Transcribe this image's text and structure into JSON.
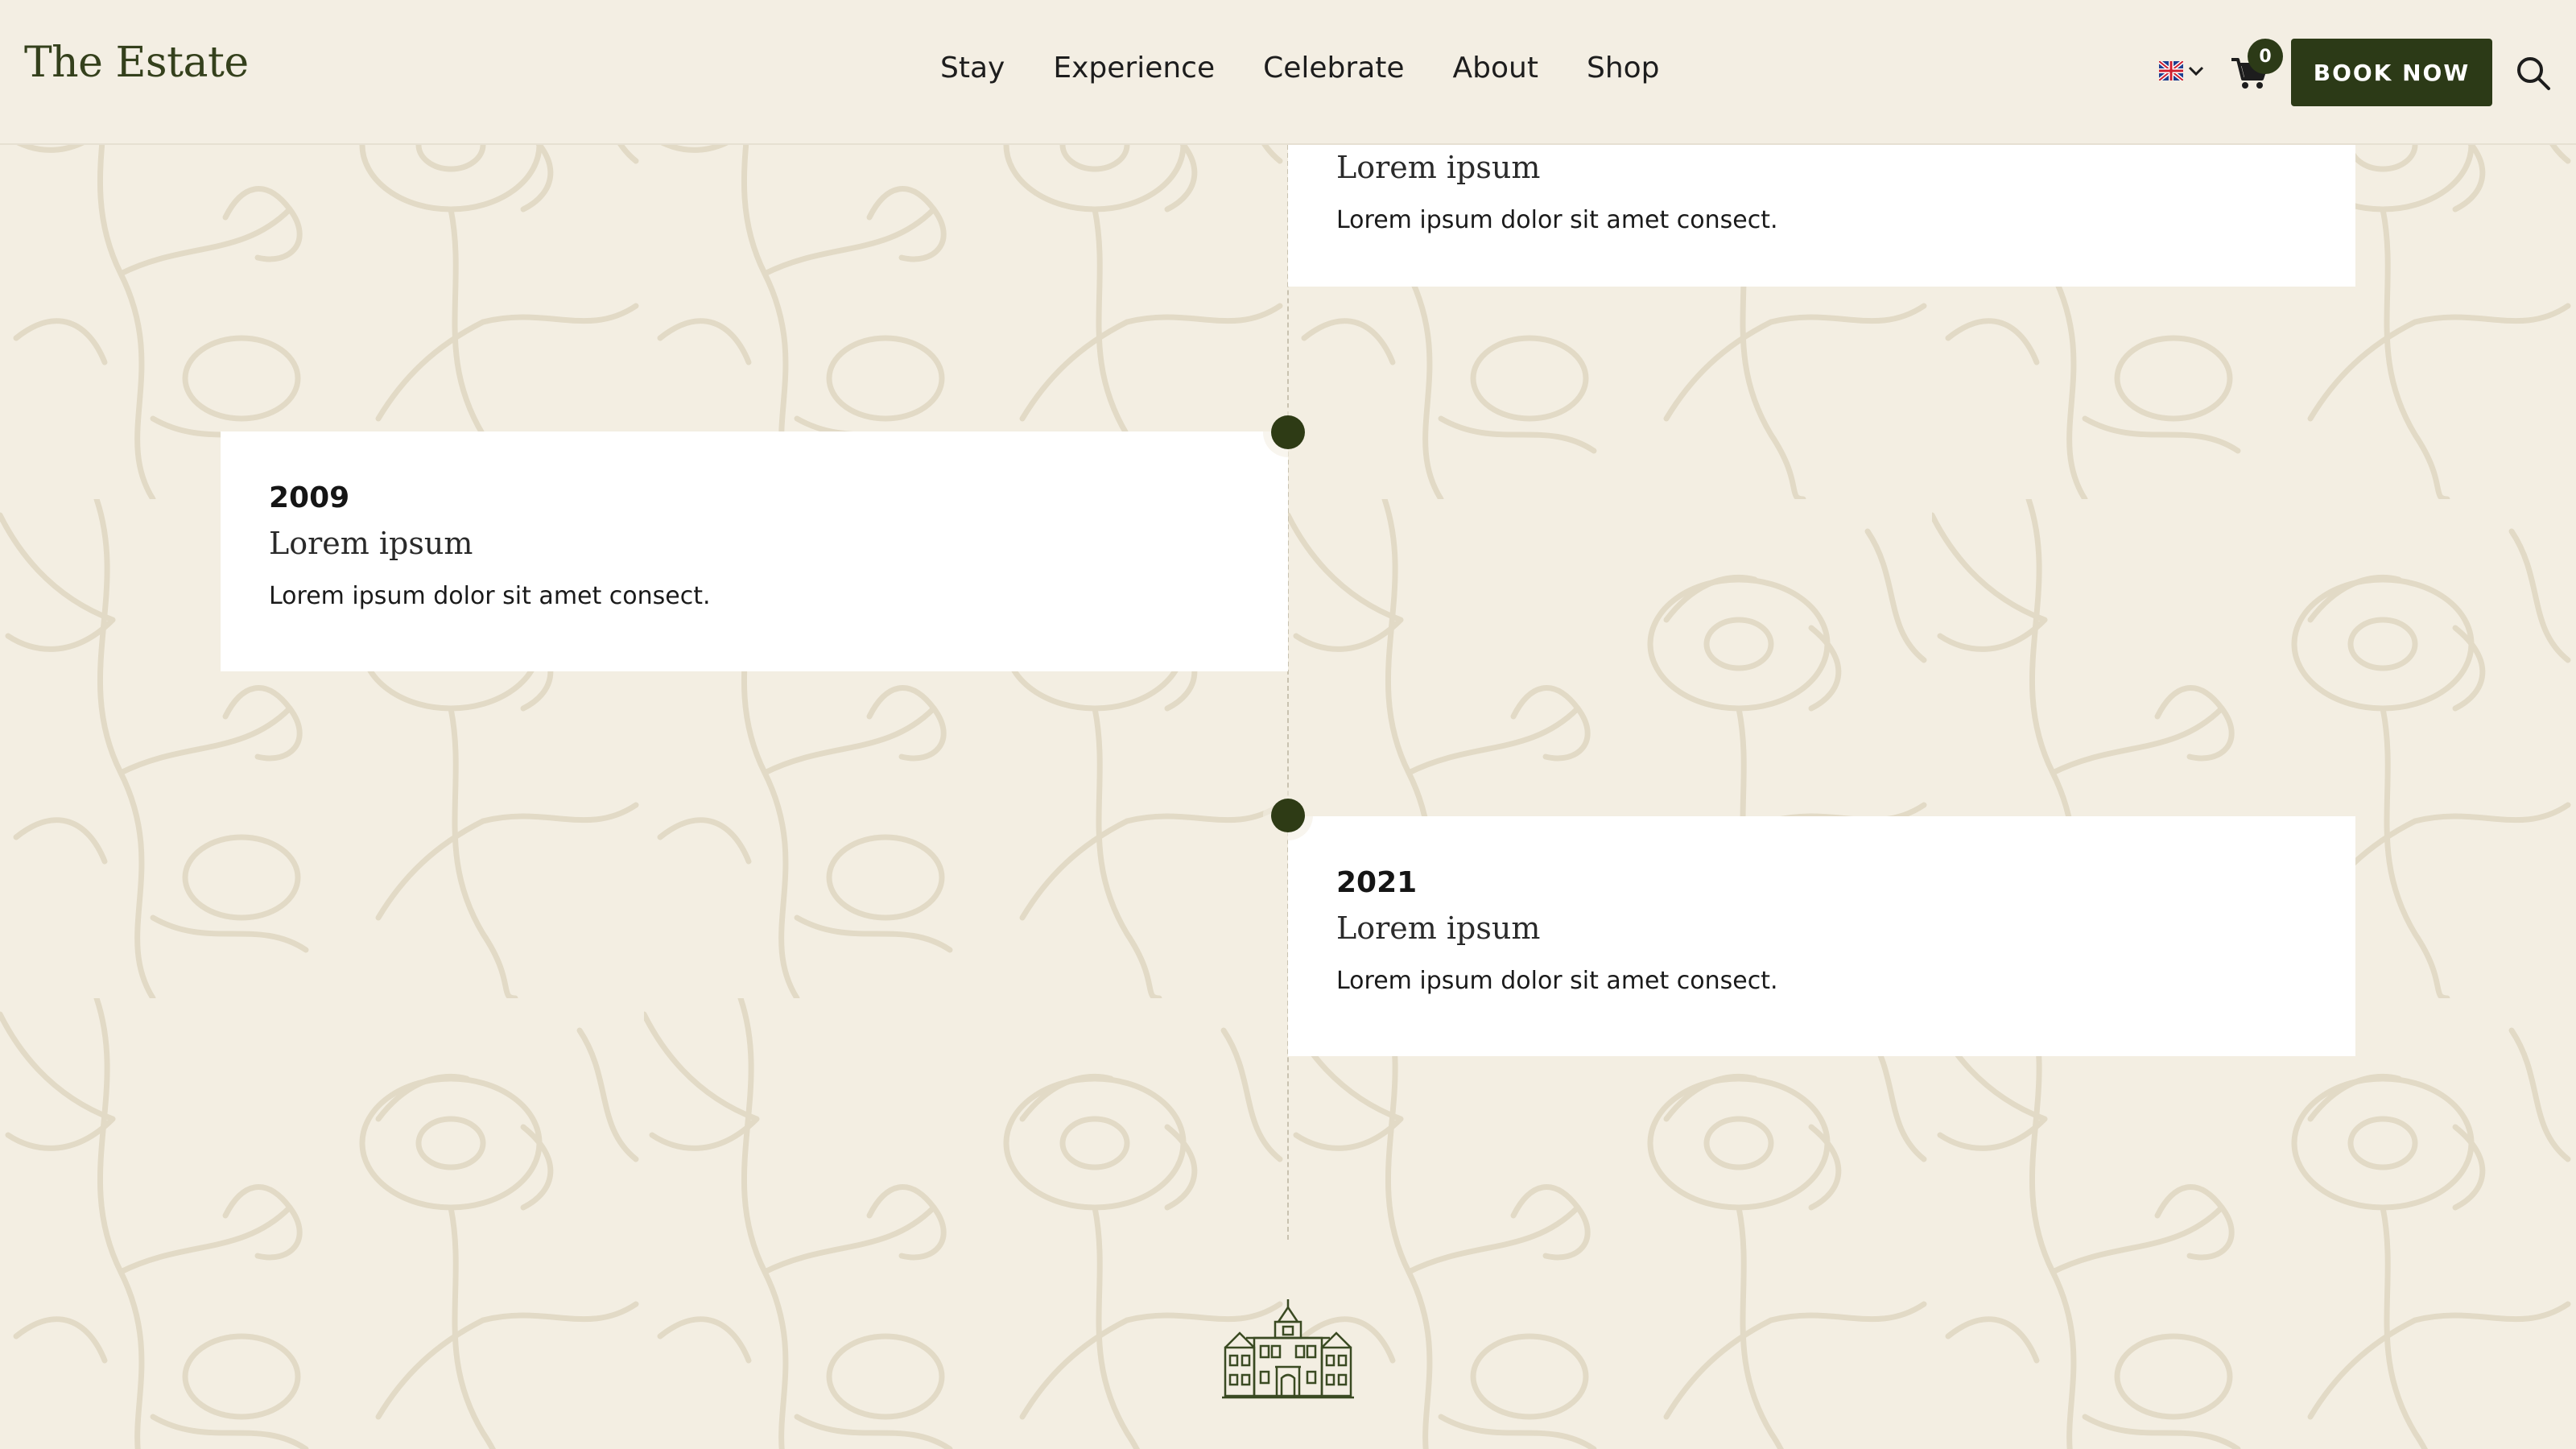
{
  "header": {
    "logo": "The Estate",
    "nav": [
      "Stay",
      "Experience",
      "Celebrate",
      "About",
      "Shop"
    ],
    "language_flag": "uk-flag-icon",
    "cart_count": "0",
    "book_label": "BOOK NOW"
  },
  "timeline": [
    {
      "year": "",
      "title": "Lorem ipsum",
      "desc": "Lorem ipsum dolor sit amet consect.",
      "side": "right"
    },
    {
      "year": "2009",
      "title": "Lorem ipsum",
      "desc": "Lorem ipsum dolor sit amet consect.",
      "side": "left"
    },
    {
      "year": "2021",
      "title": "Lorem ipsum",
      "desc": "Lorem ipsum dolor sit amet consect.",
      "side": "right"
    }
  ],
  "colors": {
    "background": "#f3eee2",
    "accent": "#2c3a17",
    "logo": "#34401c",
    "pattern": "#e3dcc9"
  },
  "footer_icon": "manor-house-icon"
}
